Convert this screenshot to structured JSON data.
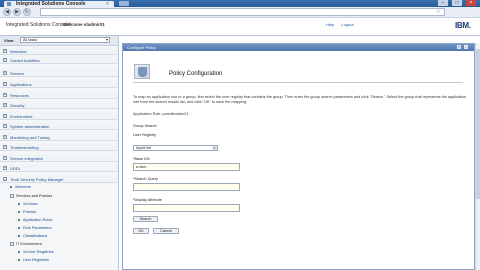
{
  "browser": {
    "tab_title": "Integrated Solutions Console",
    "tab_close": "×",
    "win_minimize": "–",
    "win_maximize": "□",
    "win_close": "×",
    "back_glyph": "◀",
    "forward_glyph": "▶",
    "reload_glyph": "↻",
    "bookmark_glyph": "☆"
  },
  "app_header": {
    "product": "Integrated Solutions Console",
    "welcome": "Welcome vladmir01",
    "help_link": "Help",
    "logout_link": "Logout",
    "logo": "IBM."
  },
  "left_nav": {
    "view_label": "View:",
    "view_value": "All tasks",
    "items": [
      {
        "pm": "+",
        "label": "Welcome"
      },
      {
        "pm": "+",
        "label": "Guided Activities"
      },
      {
        "pm": "+",
        "label": "Servers"
      },
      {
        "pm": "+",
        "label": "Applications"
      },
      {
        "pm": "+",
        "label": "Resources"
      },
      {
        "pm": "+",
        "label": "Security"
      },
      {
        "pm": "+",
        "label": "Environment"
      },
      {
        "pm": "+",
        "label": "System administration"
      },
      {
        "pm": "+",
        "label": "Monitoring and Tuning"
      },
      {
        "pm": "+",
        "label": "Troubleshooting"
      },
      {
        "pm": "+",
        "label": "Service integration"
      },
      {
        "pm": "+",
        "label": "UDDI"
      },
      {
        "pm": "–",
        "label": "Tivoli Security Policy Manager"
      }
    ],
    "tspm": {
      "welcome": "Welcome",
      "services_group": "Services and Policies",
      "services_children": [
        "Services",
        "Policies",
        "Application Roles",
        "Role Parameters",
        "Classifications"
      ],
      "it_group": "IT Environment",
      "it_children": [
        "Service Registries",
        "User Registries"
      ]
    }
  },
  "panel": {
    "header": "Configure Policy",
    "header_icons": [
      "?",
      "–"
    ],
    "title": "Policy Configuration",
    "instructions": "To map an application role to a group, first select the user registry that contains the group. Then enter the group search parameters and click \"Search.\" Select the group that represents the application role from the search results list, and click \"OK\" to save the mapping.",
    "application_role": "Application Role: puredtlvladm01",
    "group_search": "Group Search",
    "user_registry_label": "User Registry",
    "user_registry_value": "liquid.lmf",
    "base_dn_label": "*Base DN",
    "base_dn_value": "o=ibm",
    "search_query_label": "*Search Query",
    "search_query_value": "",
    "display_attr_label": "*Display Attribute",
    "display_attr_value": "",
    "search_button": "Search",
    "ok_button": "OK",
    "cancel_button": "Cancel"
  }
}
